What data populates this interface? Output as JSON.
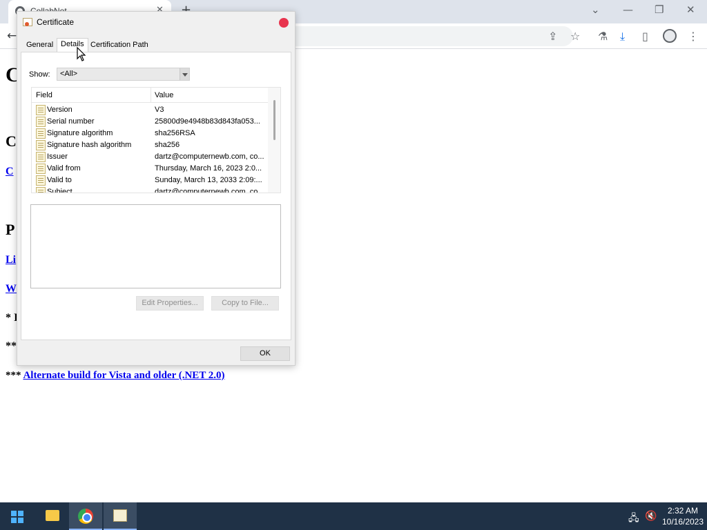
{
  "browser": {
    "tab_title": "CollabNet",
    "new_tab_label": "+",
    "minimize": "—",
    "restore": "❐",
    "close": "✕",
    "tab_list": "⌄"
  },
  "page": {
    "big_heading": "C",
    "heading2a": "C",
    "link1": "C",
    "heading2b": "P",
    "link2": "Li",
    "link3": "W",
    "note1": "* I",
    "note2": "**",
    "alt_prefix": "*** ",
    "alt_link": "Alternate build for Vista and older (.NET 2.0)"
  },
  "dialog": {
    "title": "Certificate",
    "tabs": [
      "General",
      "Details",
      "Certification Path"
    ],
    "show_label": "Show:",
    "show_value": "<All>",
    "col_field": "Field",
    "col_value": "Value",
    "rows": [
      {
        "field": "Version",
        "value": "V3"
      },
      {
        "field": "Serial number",
        "value": "25800d9e4948b83d843fa053..."
      },
      {
        "field": "Signature algorithm",
        "value": "sha256RSA"
      },
      {
        "field": "Signature hash algorithm",
        "value": "sha256"
      },
      {
        "field": "Issuer",
        "value": "dartz@computernewb.com, co..."
      },
      {
        "field": "Valid from",
        "value": "Thursday, March 16, 2023 2:0..."
      },
      {
        "field": "Valid to",
        "value": "Sunday, March 13, 2033 2:09:..."
      },
      {
        "field": "Subject",
        "value": "dartz@computernewb.com, co..."
      }
    ],
    "edit_properties": "Edit Properties...",
    "copy_to_file": "Copy to File...",
    "ok": "OK"
  },
  "taskbar": {
    "time": "2:32 AM",
    "date": "10/16/2023"
  },
  "colors": {
    "link": "#0000ee",
    "close_dot": "#e8344e",
    "taskbar": "#1f3146"
  }
}
